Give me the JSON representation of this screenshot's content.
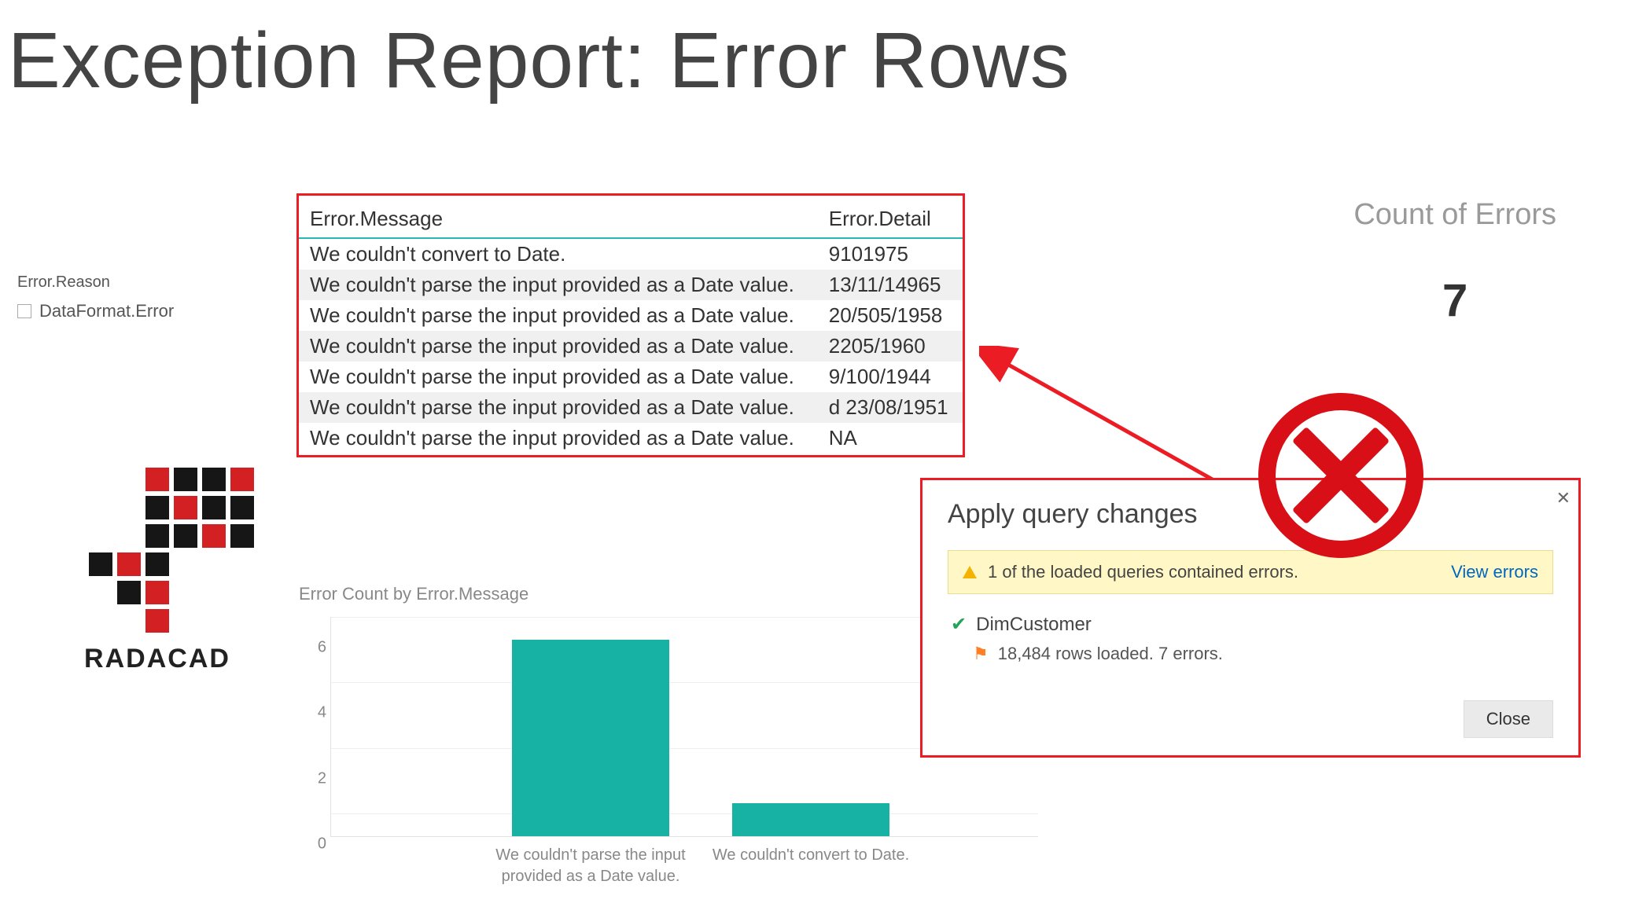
{
  "page": {
    "title": "Exception Report: Error Rows"
  },
  "slicer": {
    "title": "Error.Reason",
    "items": [
      "DataFormat.Error"
    ]
  },
  "error_table": {
    "headers": {
      "message": "Error.Message",
      "detail": "Error.Detail"
    },
    "rows": [
      {
        "message": "We couldn't convert to Date.",
        "detail": "9101975"
      },
      {
        "message": "We couldn't parse the input provided as a Date value.",
        "detail": "13/11/14965"
      },
      {
        "message": "We couldn't parse the input provided as a Date value.",
        "detail": "20/505/1958"
      },
      {
        "message": "We couldn't parse the input provided as a Date value.",
        "detail": "2205/1960"
      },
      {
        "message": "We couldn't parse the input provided as a Date value.",
        "detail": "9/100/1944"
      },
      {
        "message": "We couldn't parse the input provided as a Date value.",
        "detail": "d 23/08/1951"
      },
      {
        "message": "We couldn't parse the input provided as a Date value.",
        "detail": "NA"
      }
    ]
  },
  "card": {
    "title": "Count of Errors",
    "value": "7"
  },
  "logo": {
    "text": "RADACAD"
  },
  "chart_data": {
    "type": "bar",
    "title": "Error Count by Error.Message",
    "categories": [
      "We couldn't parse the input provided as a Date value.",
      "We couldn't convert to Date."
    ],
    "values": [
      6,
      1
    ],
    "ylim": [
      0,
      6
    ],
    "yticks": [
      0,
      2,
      4,
      6
    ],
    "xlabel": "",
    "ylabel": ""
  },
  "dialog": {
    "title": "Apply query changes",
    "warning_text": "1 of the loaded queries contained errors.",
    "view_link": "View errors",
    "query_name": "DimCustomer",
    "detail_text": "18,484 rows loaded. 7 errors.",
    "close_label": "Close"
  }
}
